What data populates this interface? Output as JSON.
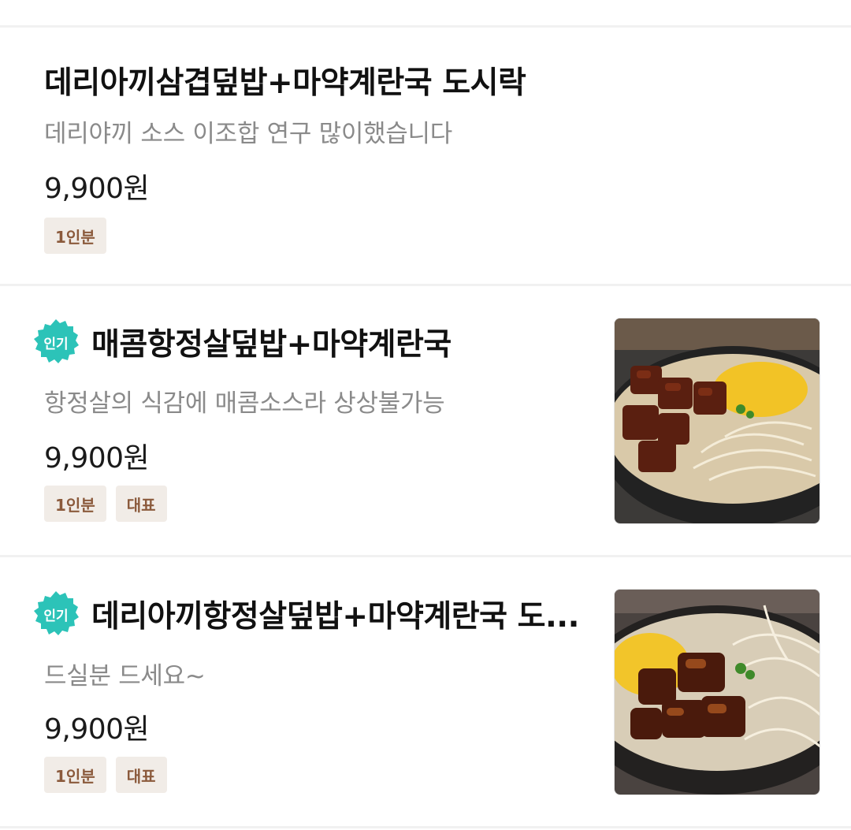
{
  "menu_items": [
    {
      "title": "데리아끼삼겹덮밥+마약계란국 도시락",
      "description": "데리야끼 소스 이조합 연구 많이했습니다",
      "price": "9,900원",
      "tags": [
        "1인분"
      ]
    },
    {
      "badge": "인기",
      "title": "매콤항정살덮밥+마약계란국",
      "description": "항정살의 식감에 매콤소스라 상상불가능",
      "price": "9,900원",
      "tags": [
        "1인분",
        "대표"
      ]
    },
    {
      "badge": "인기",
      "title": "데리아끼항정살덮밥+마약계란국 도...",
      "description": "드실분 드세요~",
      "price": "9,900원",
      "tags": [
        "1인분",
        "대표"
      ]
    }
  ],
  "colors": {
    "badge": "#2cc3b8",
    "tag_bg": "#f1ece7",
    "tag_text": "#8b5a3c",
    "description": "#8a8a8a"
  }
}
